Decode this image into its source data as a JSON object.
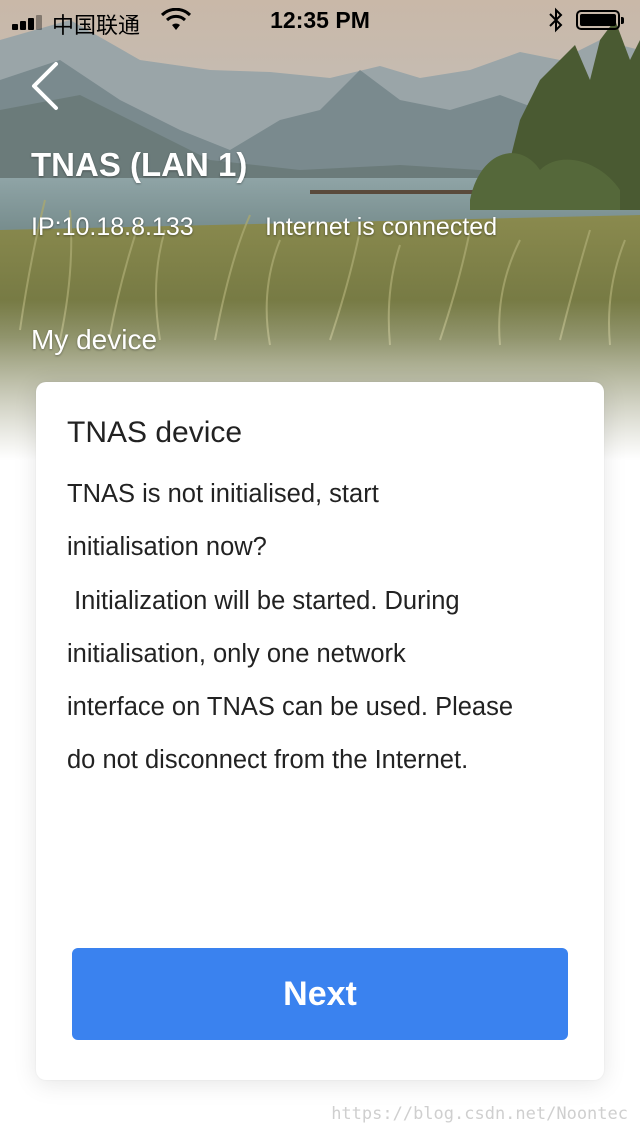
{
  "status_bar": {
    "carrier": "中国联通",
    "time": "12:35 PM"
  },
  "header": {
    "title": "TNAS (LAN 1)",
    "ip": "IP:10.18.8.133",
    "connection_status": "Internet is connected",
    "section_label": "My device"
  },
  "card": {
    "title": "TNAS device",
    "message": "TNAS is not initialised, start\ninitialisation now?\n Initialization will be started. During\ninitialisation, only one network\ninterface on TNAS can be used. Please\ndo not disconnect from the Internet.",
    "button_label": "Next"
  },
  "watermark": "https://blog.csdn.net/Noontec",
  "colors": {
    "accent": "#3a82ef",
    "text": "#222222",
    "header_text": "#ffffff"
  },
  "icons": {
    "back": "chevron-left-icon",
    "wifi": "wifi-icon",
    "bluetooth": "bluetooth-icon",
    "battery": "battery-icon",
    "signal": "signal-icon"
  }
}
